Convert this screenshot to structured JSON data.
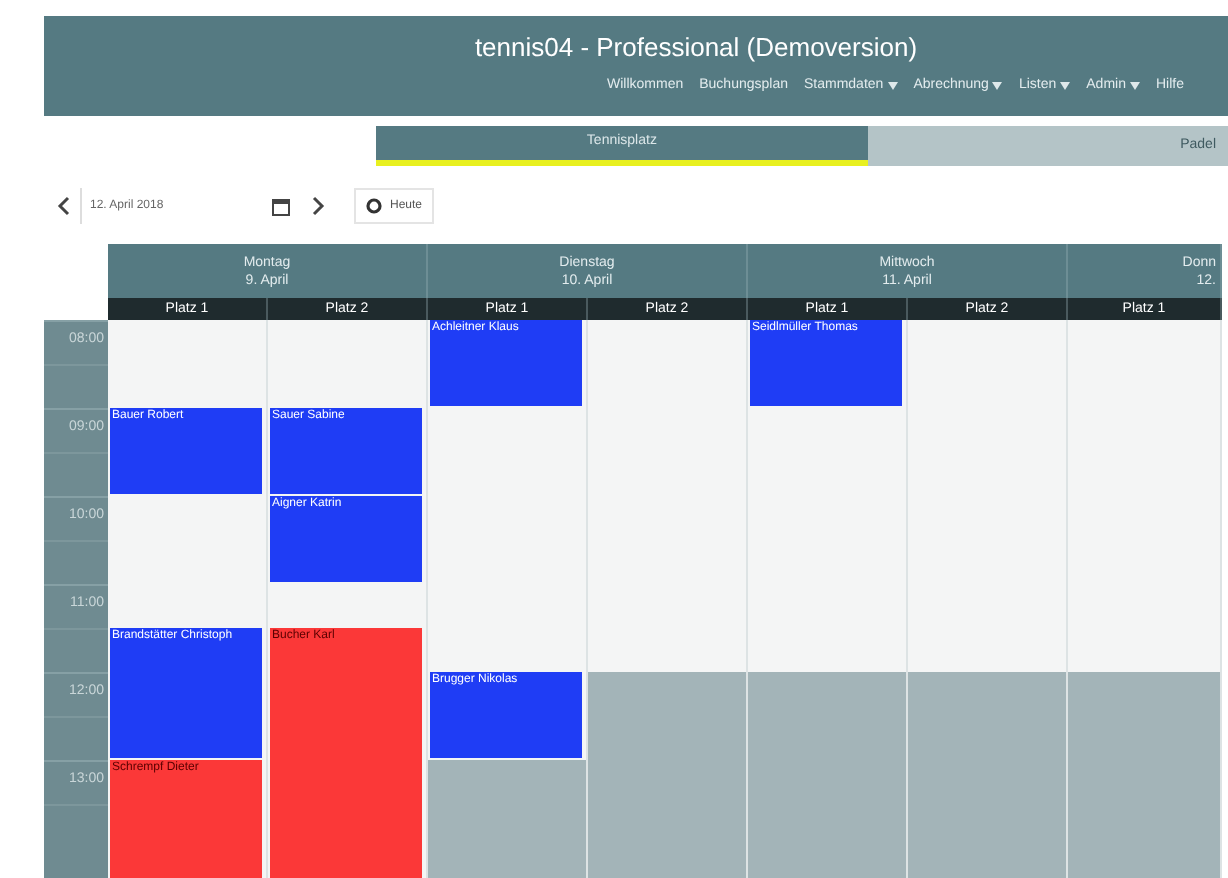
{
  "header": {
    "title": "tennis04 - Professional (Demoversion)",
    "nav": [
      {
        "label": "Willkommen",
        "dropdown": false
      },
      {
        "label": "Buchungsplan",
        "dropdown": false
      },
      {
        "label": "Stammdaten",
        "dropdown": true
      },
      {
        "label": "Abrechnung",
        "dropdown": true
      },
      {
        "label": "Listen",
        "dropdown": true
      },
      {
        "label": "Admin",
        "dropdown": true
      },
      {
        "label": "Hilfe",
        "dropdown": false
      }
    ]
  },
  "tabs": [
    {
      "label": "Tennisplatz",
      "selected": true
    },
    {
      "label": "Padel",
      "selected": false
    }
  ],
  "toolbar": {
    "date": "12. April 2018",
    "today": "Heute"
  },
  "times": [
    "08:00",
    "09:00",
    "10:00",
    "11:00",
    "12:00",
    "13:00"
  ],
  "days": [
    {
      "name": "Montag",
      "date": "9. April",
      "partial": false,
      "courts": [
        {
          "label": "Platz 1",
          "slots": [
            {
              "kind": "free"
            },
            {
              "kind": "free"
            },
            {
              "kind": "booking",
              "name": "Bauer Robert",
              "color": "#1f3df5"
            },
            {
              "kind": "cont"
            },
            {
              "kind": "free"
            },
            {
              "kind": "free"
            },
            {
              "kind": "free"
            },
            {
              "kind": "booking",
              "name": "Brandstätter Christoph",
              "color": "#1f3df5"
            },
            {
              "kind": "cont"
            },
            {
              "kind": "cont"
            },
            {
              "kind": "booking",
              "name": "Schrempf Dieter",
              "color": "#fb3838"
            },
            {
              "kind": "cont"
            },
            {
              "kind": "cont"
            }
          ]
        },
        {
          "label": "Platz 2",
          "slots": [
            {
              "kind": "free"
            },
            {
              "kind": "free"
            },
            {
              "kind": "booking",
              "name": "Sauer Sabine",
              "color": "#1f3df5"
            },
            {
              "kind": "cont"
            },
            {
              "kind": "booking",
              "name": "Aigner Katrin",
              "color": "#1f3df5"
            },
            {
              "kind": "cont"
            },
            {
              "kind": "free"
            },
            {
              "kind": "booking",
              "name": "Bucher Karl",
              "color": "#fb3838"
            },
            {
              "kind": "cont"
            },
            {
              "kind": "cont"
            },
            {
              "kind": "cont"
            },
            {
              "kind": "cont"
            },
            {
              "kind": "cont"
            }
          ]
        }
      ]
    },
    {
      "name": "Dienstag",
      "date": "10. April",
      "partial": false,
      "courts": [
        {
          "label": "Platz 1",
          "slots": [
            {
              "kind": "booking",
              "name": "Achleitner Klaus",
              "color": "#1f3df5"
            },
            {
              "kind": "cont"
            },
            {
              "kind": "free"
            },
            {
              "kind": "free"
            },
            {
              "kind": "free"
            },
            {
              "kind": "free"
            },
            {
              "kind": "free"
            },
            {
              "kind": "free"
            },
            {
              "kind": "booking",
              "name": "Brugger Nikolas",
              "color": "#1f3df5"
            },
            {
              "kind": "cont"
            },
            {
              "kind": "blocked"
            },
            {
              "kind": "blocked"
            },
            {
              "kind": "blocked"
            }
          ]
        },
        {
          "label": "Platz 2",
          "slots": [
            {
              "kind": "free"
            },
            {
              "kind": "free"
            },
            {
              "kind": "free"
            },
            {
              "kind": "free"
            },
            {
              "kind": "free"
            },
            {
              "kind": "free"
            },
            {
              "kind": "free"
            },
            {
              "kind": "free"
            },
            {
              "kind": "blocked"
            },
            {
              "kind": "blocked"
            },
            {
              "kind": "blocked"
            },
            {
              "kind": "blocked"
            },
            {
              "kind": "blocked"
            }
          ]
        }
      ]
    },
    {
      "name": "Mittwoch",
      "date": "11. April",
      "partial": false,
      "courts": [
        {
          "label": "Platz 1",
          "slots": [
            {
              "kind": "booking",
              "name": "Seidlmüller Thomas",
              "color": "#1f3df5"
            },
            {
              "kind": "cont"
            },
            {
              "kind": "free"
            },
            {
              "kind": "free"
            },
            {
              "kind": "free"
            },
            {
              "kind": "free"
            },
            {
              "kind": "free"
            },
            {
              "kind": "free"
            },
            {
              "kind": "blocked"
            },
            {
              "kind": "blocked"
            },
            {
              "kind": "blocked"
            },
            {
              "kind": "blocked"
            },
            {
              "kind": "blocked"
            }
          ]
        },
        {
          "label": "Platz 2",
          "slots": [
            {
              "kind": "free"
            },
            {
              "kind": "free"
            },
            {
              "kind": "free"
            },
            {
              "kind": "free"
            },
            {
              "kind": "free"
            },
            {
              "kind": "free"
            },
            {
              "kind": "free"
            },
            {
              "kind": "free"
            },
            {
              "kind": "blocked"
            },
            {
              "kind": "blocked"
            },
            {
              "kind": "blocked"
            },
            {
              "kind": "blocked"
            },
            {
              "kind": "blocked"
            }
          ]
        }
      ]
    },
    {
      "name": "Donn",
      "date": "12.",
      "partial": true,
      "courts": [
        {
          "label": "Platz 1",
          "slots": [
            {
              "kind": "free"
            },
            {
              "kind": "free"
            },
            {
              "kind": "free"
            },
            {
              "kind": "free"
            },
            {
              "kind": "free"
            },
            {
              "kind": "free"
            },
            {
              "kind": "free"
            },
            {
              "kind": "free"
            },
            {
              "kind": "blocked"
            },
            {
              "kind": "blocked"
            },
            {
              "kind": "blocked"
            },
            {
              "kind": "blocked"
            },
            {
              "kind": "blocked"
            }
          ]
        }
      ]
    }
  ]
}
